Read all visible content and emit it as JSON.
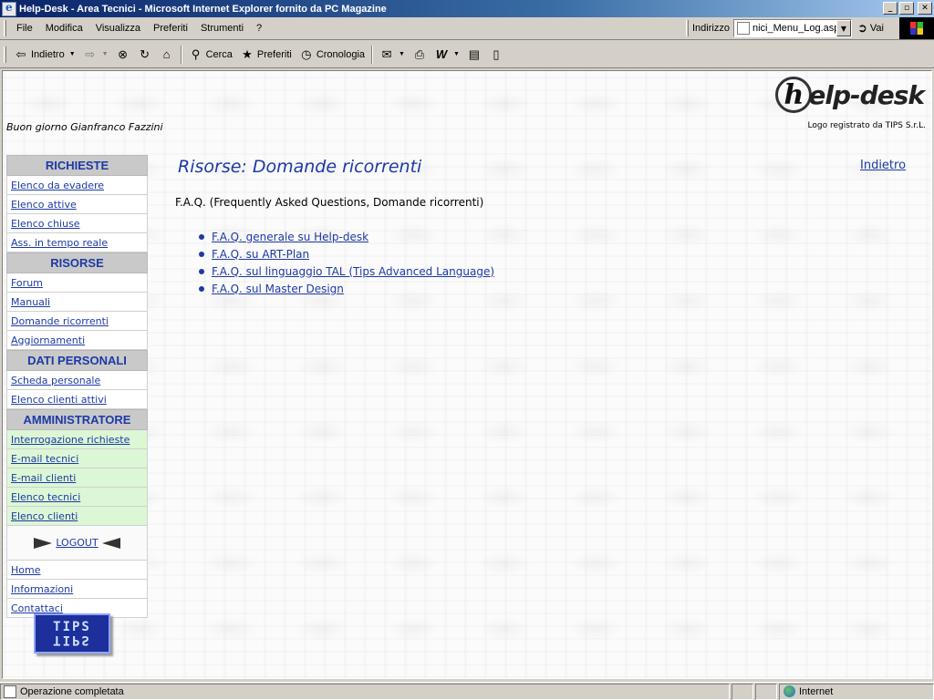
{
  "window": {
    "title": "Help-Desk - Area Tecnici - Microsoft Internet Explorer fornito da PC Magazine",
    "minimize": "_",
    "maximize": "▫",
    "close": "✕"
  },
  "menu": [
    "File",
    "Modifica",
    "Visualizza",
    "Preferiti",
    "Strumenti",
    "?"
  ],
  "address": {
    "label": "Indirizzo",
    "value": "nici_Menu_Log.asp",
    "go": "Vai"
  },
  "toolbar": {
    "back": "Indietro",
    "search": "Cerca",
    "favorites": "Preferiti",
    "history": "Cronologia"
  },
  "header": {
    "logo_text": "elp-desk",
    "logo_letter": "h",
    "logo_note": "Logo registrato da TIPS S.r.L.",
    "greeting": "Buon giorno Gianfranco Fazzini"
  },
  "sidebar": {
    "sections": [
      {
        "title": "RICHIESTE",
        "items": [
          "Elenco da evadere",
          "Elenco attive",
          "Elenco chiuse",
          "Ass. in tempo reale"
        ]
      },
      {
        "title": "RISORSE",
        "items": [
          "Forum",
          "Manuali",
          "Domande ricorrenti",
          "Aggiornamenti"
        ]
      },
      {
        "title": "DATI PERSONALI",
        "items": [
          "Scheda personale",
          "Elenco clienti attivi"
        ]
      },
      {
        "title": "AMMINISTRATORE",
        "items": [
          "Interrogazione richieste",
          "E-mail tecnici",
          "E-mail clienti",
          "Elenco tecnici",
          "Elenco clienti"
        ]
      }
    ],
    "logout": "LOGOUT",
    "footer_links": [
      "Home",
      "Informazioni",
      "Contattaci"
    ],
    "tips_logo": "TIPS"
  },
  "main": {
    "title": "Risorse: Domande ricorrenti",
    "back_link": "Indietro",
    "intro": "F.A.Q. (Frequently Asked Questions, Domande ricorrenti)",
    "faq_links": [
      "F.A.Q. generale su Help-desk",
      "F.A.Q. su ART-Plan",
      "F.A.Q. sul linguaggio TAL (Tips Advanced Language)",
      "F.A.Q. sul Master Design"
    ]
  },
  "status": {
    "text": "Operazione completata",
    "zone": "Internet"
  },
  "colors": {
    "link": "#1d3aa6",
    "section_bg": "#c9c9c9",
    "admin_item_bg": "#dcf7d5"
  }
}
